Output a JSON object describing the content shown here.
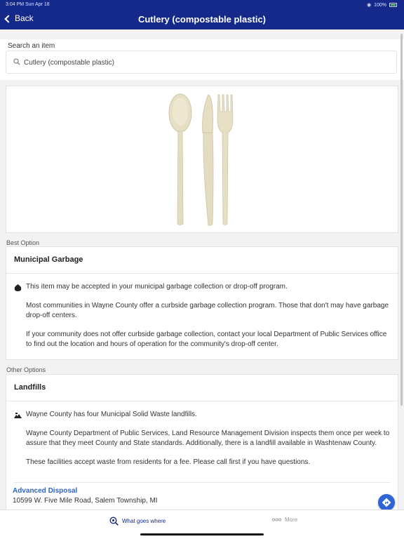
{
  "status_bar": {
    "time": "3:04 PM  Sun Apr 18",
    "battery": "100%"
  },
  "header": {
    "back_label": "Back",
    "title": "Cutlery (compostable plastic)"
  },
  "search": {
    "label": "Search an item",
    "value": "Cutlery (compostable plastic)",
    "icon": "search-icon"
  },
  "image": {
    "subject": "compostable spoon, knife and fork"
  },
  "best_option": {
    "section_label": "Best Option",
    "title": "Municipal Garbage",
    "icon": "garbage-bag-icon",
    "paragraphs": [
      "This item may be accepted in your municipal garbage collection or drop-off program.",
      "Most communities in Wayne County offer a curbside garbage collection program. Those that don't may have garbage drop-off centers.",
      "If your community does not offer curbside garbage collection, contact your local Department of Public Services office to find out the location and hours of operation for the community's drop-off center."
    ]
  },
  "other_options": {
    "section_label": "Other Options",
    "title": "Landfills",
    "icon": "landfill-icon",
    "paragraphs": [
      "Wayne County has four Municipal Solid Waste landfills.",
      "Wayne County Department of Public Services, Land Resource Management Division inspects them once per week to assure that they meet County and State standards. Additionally, there is a landfill available in Washtenaw County.",
      "These facilities accept waste from residents for a fee. Please call first if you have questions."
    ],
    "link_label": "Advanced Disposal",
    "address": "10599 W. Five Mile Road, Salem Township, MI"
  },
  "tab_bar": {
    "tabs": [
      {
        "label": "What goes where",
        "icon": "search-location-icon",
        "active": true
      },
      {
        "label": "More",
        "icon": "more-dots-icon",
        "active": false
      }
    ]
  },
  "colors": {
    "header": "#15298a",
    "link": "#2e64c8",
    "fab": "#2f63d6"
  }
}
